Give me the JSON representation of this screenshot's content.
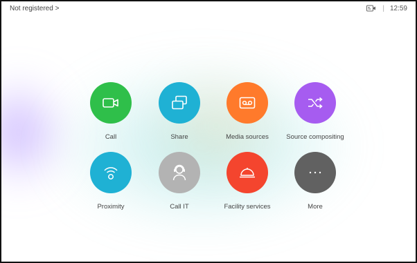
{
  "status_bar": {
    "registration": "Not registered >",
    "separator": "|",
    "time": "12:59",
    "camera_icon": "camera-status-icon"
  },
  "tiles": [
    {
      "label": "Call",
      "icon": "video-camera-icon",
      "color": "#2fbf4a"
    },
    {
      "label": "Share",
      "icon": "share-screens-icon",
      "color": "#1fb1d4"
    },
    {
      "label": "Media sources",
      "icon": "media-tape-icon",
      "color": "#ff7a2b"
    },
    {
      "label": "Source compositing",
      "icon": "shuffle-icon",
      "color": "#a65cf0"
    },
    {
      "label": "Proximity",
      "icon": "proximity-wave-icon",
      "color": "#1fb1d4"
    },
    {
      "label": "Call IT",
      "icon": "headset-agent-icon",
      "color": "#b3b3b3"
    },
    {
      "label": "Facility services",
      "icon": "service-bell-icon",
      "color": "#f4452e"
    },
    {
      "label": "More",
      "icon": "more-dots-icon",
      "color": "#616161"
    }
  ]
}
